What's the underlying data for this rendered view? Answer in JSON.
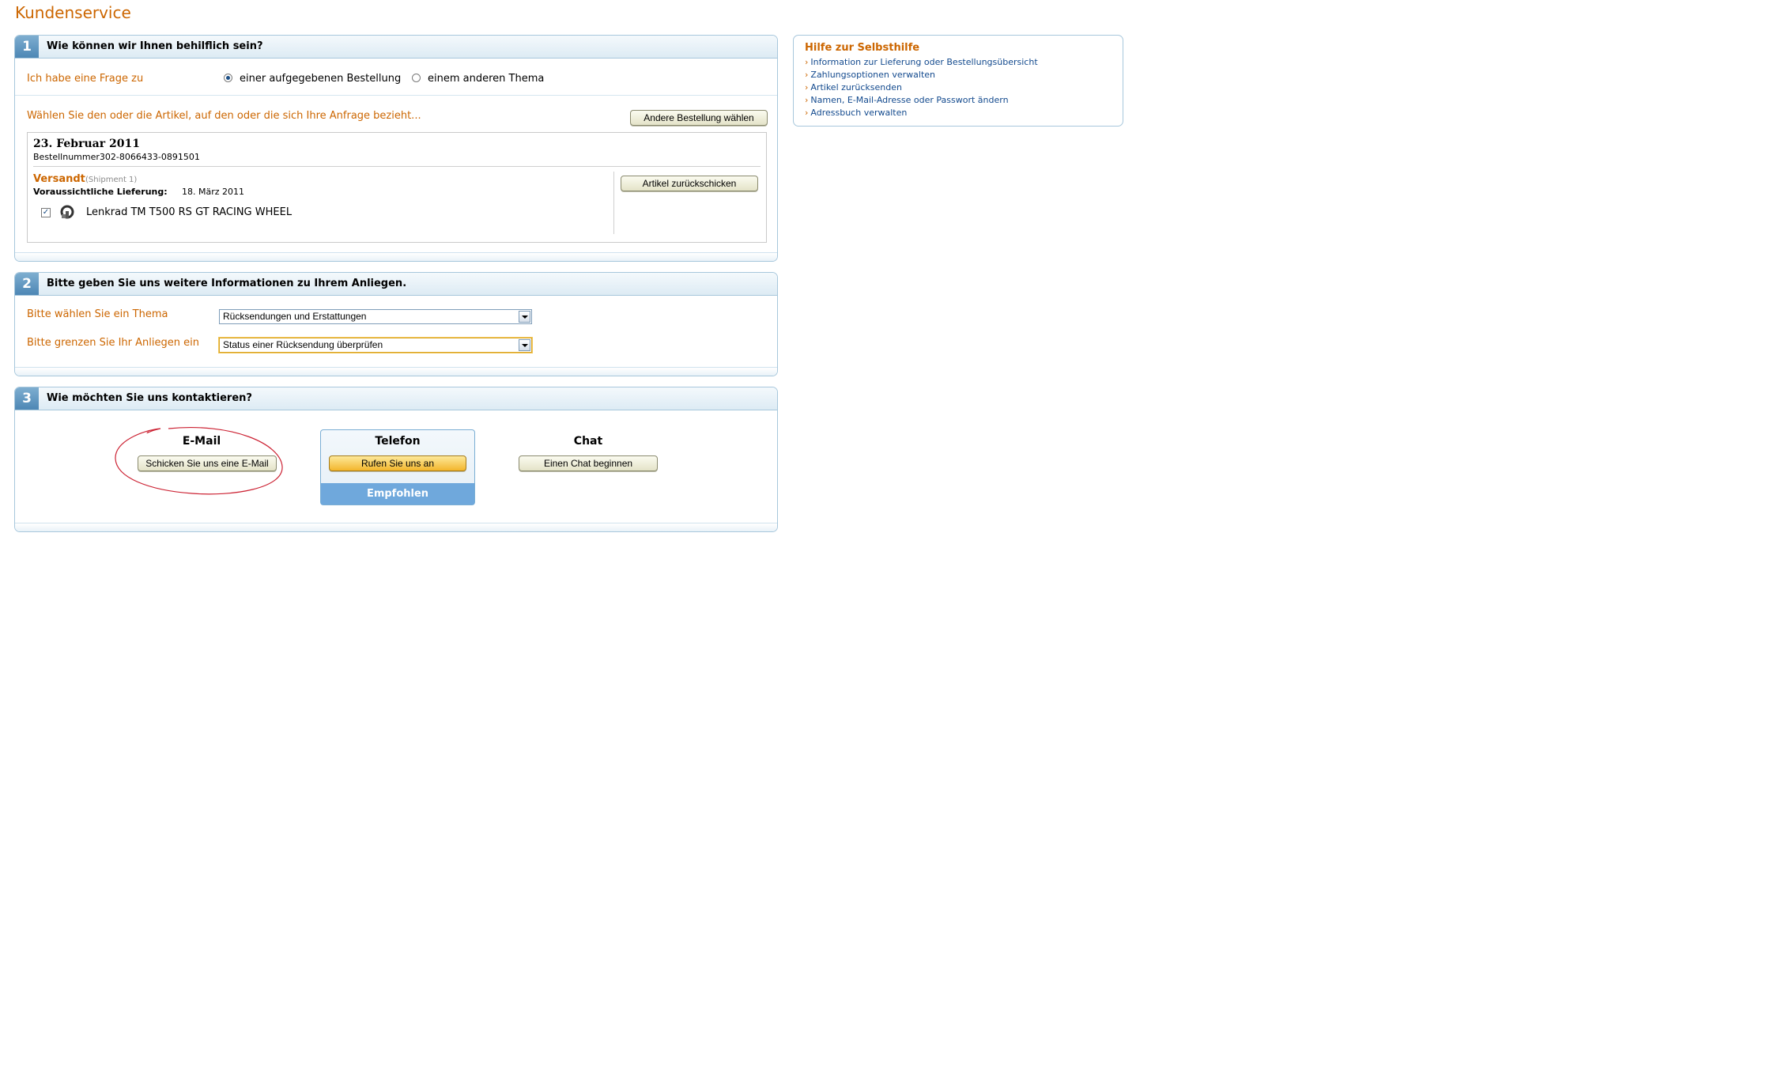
{
  "page": {
    "title": "Kundenservice"
  },
  "step1": {
    "number": "1",
    "title": "Wie können wir Ihnen behilflich sein?",
    "question_label": "Ich habe eine Frage zu",
    "radio_order": "einer aufgegebenen Bestellung",
    "radio_other": "einem anderen Thema",
    "selected_radio": "order",
    "select_items_hint": "Wählen Sie den oder die Artikel, auf den oder die sich Ihre Anfrage bezieht...",
    "other_order_button": "Andere Bestellung wählen",
    "order": {
      "date": "23. Februar 2011",
      "order_number": "Bestellnummer302-8066433-0891501",
      "status": "Versandt",
      "shipment": "(Shipment 1)",
      "delivery_label": "Voraussichtliche Lieferung:",
      "delivery_date": "18. März 2011",
      "return_button": "Artikel zurückschicken",
      "item_name": "Lenkrad TM T500 RS GT RACING WHEEL",
      "item_checked": true
    }
  },
  "step2": {
    "number": "2",
    "title": "Bitte geben Sie uns weitere Informationen zu Ihrem Anliegen.",
    "topic_label": "Bitte wählen Sie ein Thema",
    "topic_value": "Rücksendungen und Erstattungen",
    "narrow_label": "Bitte grenzen Sie Ihr Anliegen ein",
    "narrow_value": "Status einer Rücksendung überprüfen"
  },
  "step3": {
    "number": "3",
    "title": "Wie möchten Sie uns kontaktieren?",
    "email": {
      "title": "E-Mail",
      "button": "Schicken Sie uns eine E-Mail"
    },
    "phone": {
      "title": "Telefon",
      "button": "Rufen Sie uns an",
      "recommended": "Empfohlen"
    },
    "chat": {
      "title": "Chat",
      "button": "Einen Chat beginnen"
    }
  },
  "help": {
    "title": "Hilfe zur Selbsthilfe",
    "links": [
      "Information zur Lieferung oder Bestellungsübersicht",
      "Zahlungsoptionen verwalten",
      "Artikel zurücksenden",
      "Namen, E-Mail-Adresse oder Passwort ändern",
      "Adressbuch verwalten"
    ]
  },
  "colors": {
    "accent": "#cc6600",
    "link": "#134a8e",
    "section_border": "#a7c7dc",
    "annotation": "#cc2233"
  }
}
